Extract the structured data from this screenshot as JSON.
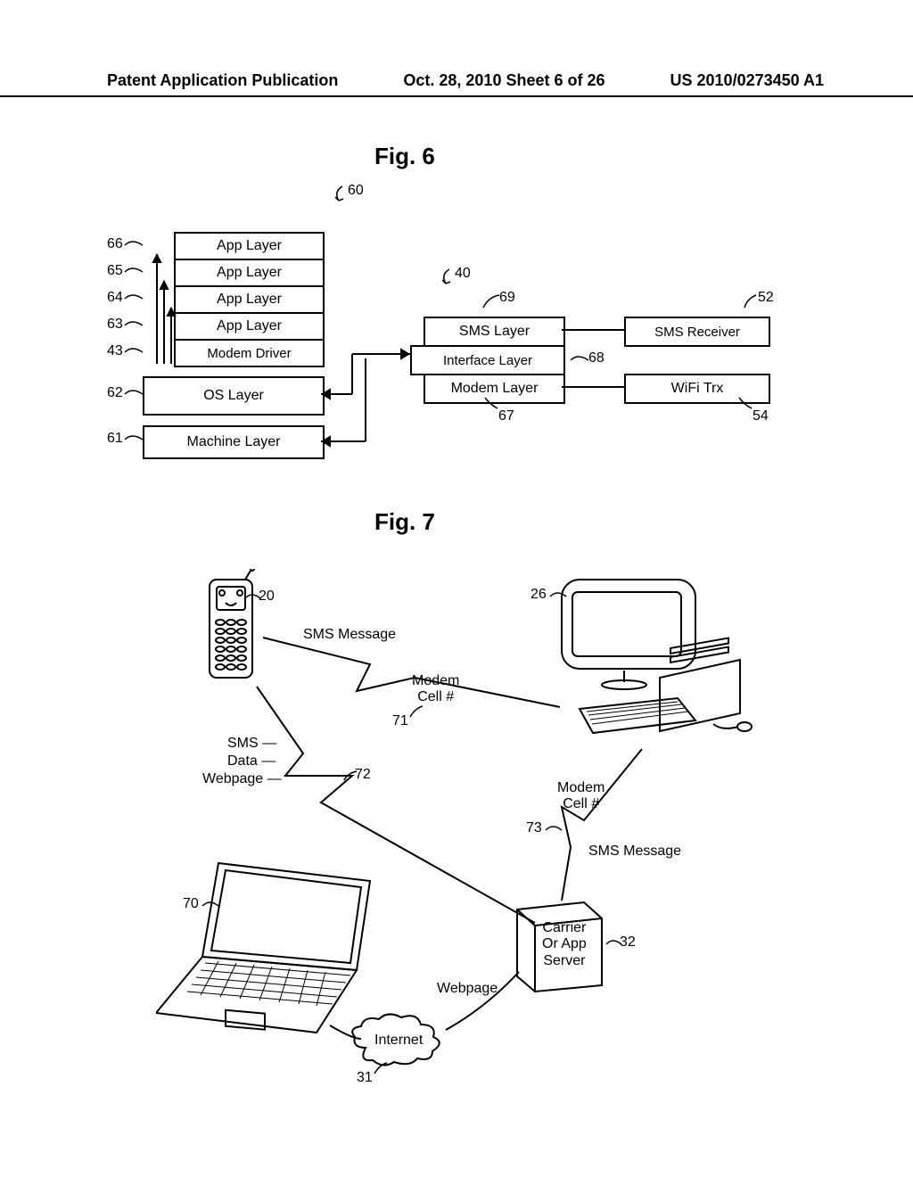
{
  "header": {
    "left": "Patent Application Publication",
    "center": "Oct. 28, 2010  Sheet 6 of 26",
    "right": "US 2010/0273450 A1"
  },
  "fig6": {
    "title": "Fig. 6",
    "stack": {
      "ref60": "60",
      "ref66": "66",
      "b66": "App Layer",
      "ref65": "65",
      "b65": "App Layer",
      "ref64": "64",
      "b64": "App Layer",
      "ref63": "63",
      "b63": "App Layer",
      "ref43": "43",
      "b43": "Modem Driver",
      "ref62": "62",
      "b62": "OS Layer",
      "ref61": "61",
      "b61": "Machine Layer"
    },
    "right": {
      "ref40": "40",
      "ref69": "69",
      "b69": "SMS Layer",
      "ref68": "68",
      "b68": "Interface Layer",
      "ref67": "67",
      "b67": "Modem Layer",
      "ref52": "52",
      "b52": "SMS Receiver",
      "ref54": "54",
      "b54": "WiFi Trx"
    }
  },
  "fig7": {
    "title": "Fig. 7",
    "ref20": "20",
    "ref26": "26",
    "ref70": "70",
    "ref71": "71",
    "ref72": "72",
    "ref73": "73",
    "ref31": "31",
    "ref32": "32",
    "labels": {
      "smsMessageTop": "SMS Message",
      "modemCell1": "Modem\nCell #",
      "sms": "SMS",
      "data": "Data",
      "webpage": "Webpage",
      "modemCell2": "Modem\nCell #",
      "smsMessageRight": "SMS Message",
      "carrierBox": "Carrier\nOr App\nServer",
      "internet": "Internet",
      "webpage2": "Webpage"
    }
  }
}
